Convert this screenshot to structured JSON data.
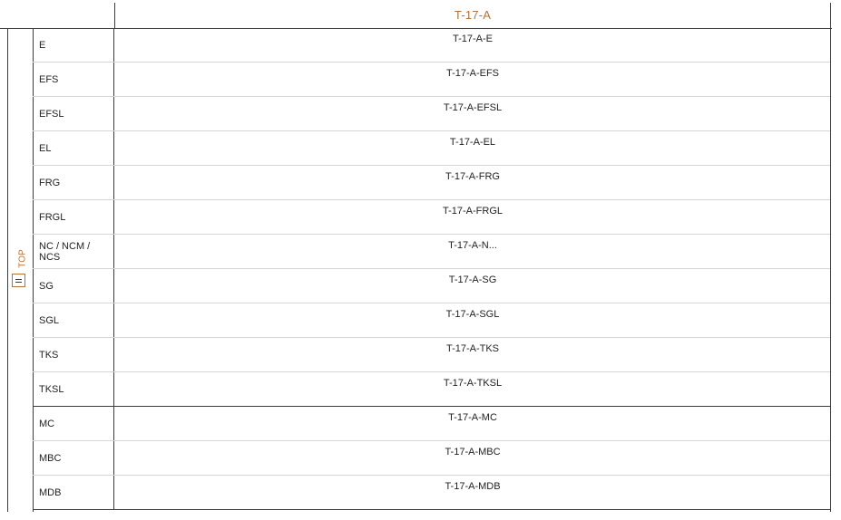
{
  "header": {
    "title": "T-17-A"
  },
  "side": {
    "label": "TOP"
  },
  "rows": [
    {
      "code": "E",
      "value": "T-17-A-E"
    },
    {
      "code": "EFS",
      "value": "T-17-A-EFS"
    },
    {
      "code": "EFSL",
      "value": "T-17-A-EFSL"
    },
    {
      "code": "EL",
      "value": "T-17-A-EL"
    },
    {
      "code": "FRG",
      "value": "T-17-A-FRG"
    },
    {
      "code": "FRGL",
      "value": "T-17-A-FRGL"
    },
    {
      "code": "NC / NCM / NCS",
      "value": "T-17-A-N..."
    },
    {
      "code": "SG",
      "value": "T-17-A-SG"
    },
    {
      "code": "SGL",
      "value": "T-17-A-SGL"
    },
    {
      "code": "TKS",
      "value": "T-17-A-TKS"
    },
    {
      "code": "TKSL",
      "value": "T-17-A-TKSL"
    },
    {
      "code": "MC",
      "value": "T-17-A-MC"
    },
    {
      "code": "MBC",
      "value": "T-17-A-MBC"
    },
    {
      "code": "MDB",
      "value": "T-17-A-MDB"
    }
  ]
}
